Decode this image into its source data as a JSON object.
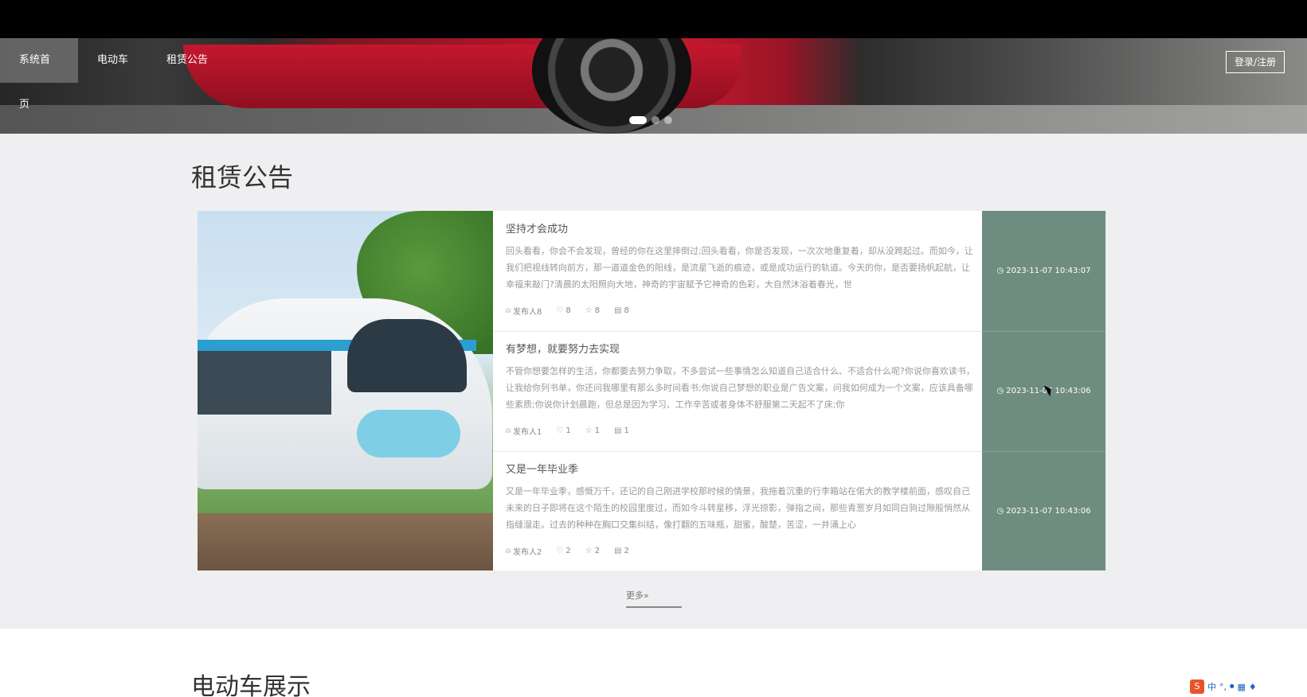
{
  "nav": {
    "items": [
      "系统首页",
      "电动车",
      "租赁公告"
    ],
    "login_label": "登录/注册"
  },
  "section": {
    "title": "租赁公告",
    "more_label": "更多»"
  },
  "notices": [
    {
      "title": "坚持才会成功",
      "desc": "回头看看，你会不会发现，曾经的你在这里摔倒过;回头看看，你是否发现，一次次地重复着，却从没跨起过。而如今，让我们把视线转向前方，那一道道金色的阳线，是流星飞逝的痕迹，或是成功运行的轨道。今天的你，是否要扬帆起航，让幸福来敲门?清晨的太阳照向大地，神奇的宇宙赋予它神奇的色彩，大自然沐浴着春光，世",
      "publisher": "发布人8",
      "likes": "8",
      "favorites": "8",
      "comments": "8",
      "date": "2023-11-07 10:43:07"
    },
    {
      "title": "有梦想，就要努力去实现",
      "desc": "不管你想要怎样的生活，你都要去努力争取，不多尝试一些事情怎么知道自己适合什么、不适合什么呢?你说你喜欢读书，让我给你列书单，你还问我哪里有那么多时间看书;你说自己梦想的职业是广告文案，问我如何成为一个文案，应该具备哪些素质;你说你计划晨跑，但总是因为学习、工作辛苦或者身体不舒服第二天起不了床;你",
      "publisher": "发布人1",
      "likes": "1",
      "favorites": "1",
      "comments": "1",
      "date": "2023-11-07 10:43:06"
    },
    {
      "title": "又是一年毕业季",
      "desc": "又是一年毕业季，感慨万千，还记的自己刚进学校那时候的情景，我拖着沉重的行李箱站在偌大的教学楼前面，感叹自己未来的日子即将在这个陌生的校园里度过，而如今斗转星移，浮光掠影，弹指之间，那些青葱岁月如同白驹过隙般悄然从指缝溜走。过去的种种在胸口交集纠结，像打翻的五味瓶，甜蜜，酸楚，苦涩，一并涌上心",
      "publisher": "发布人2",
      "likes": "2",
      "favorites": "2",
      "comments": "2",
      "date": "2023-11-07 10:43:06"
    }
  ],
  "bottom": {
    "title": "电动车展示"
  },
  "ime": {
    "lang": "中"
  },
  "colors": {
    "date_column": "#6f8c80",
    "nav_active": "#6e6e6e"
  }
}
